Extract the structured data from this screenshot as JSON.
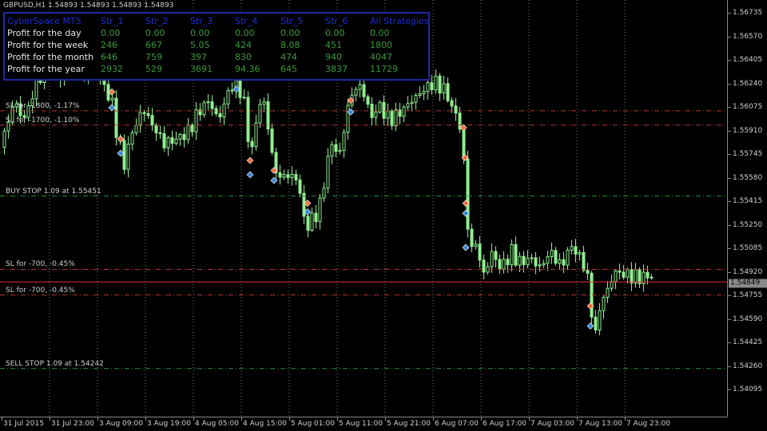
{
  "symbol_info": "GBPUSD,H1  1.54893 1.54893 1.54893 1.54893",
  "price_axis": {
    "labels": [
      "1.56735",
      "1.56570",
      "1.56405",
      "1.56240",
      "1.56075",
      "1.55910",
      "1.55745",
      "1.55580",
      "1.55415",
      "1.55250",
      "1.55085",
      "1.54920",
      "1.54755",
      "1.54590",
      "1.54425",
      "1.54260",
      "1.54095"
    ],
    "current_price": "1.54849"
  },
  "time_axis": {
    "labels": [
      "31 Jul 2015",
      "31 Jul 23:00",
      "3 Aug 09:00",
      "3 Aug 19:00",
      "4 Aug 05:00",
      "4 Aug 15:00",
      "5 Aug 01:00",
      "5 Aug 11:00",
      "5 Aug 21:00",
      "6 Aug 07:00",
      "6 Aug 17:00",
      "7 Aug 03:00",
      "7 Aug 13:00",
      "7 Aug 23:00"
    ]
  },
  "lines": [
    {
      "label": "SL for -1800, -1.17%",
      "color": "#b03a2e",
      "price": 1.56048
    },
    {
      "label": "SL for -1700, -1.10%",
      "color": "#b03a2e",
      "price": 1.55948
    },
    {
      "label": "BUY STOP 1.09 at 1.55451",
      "color": "#2e8a3a",
      "price": 1.55451
    },
    {
      "label": "SL for -700, -0.45%",
      "color": "#b03a2e",
      "price": 1.54937
    },
    {
      "label": "",
      "color": "#e03030",
      "price": 1.54849
    },
    {
      "label": "SL for -700, -0.45%",
      "color": "#b03a2e",
      "price": 1.54757
    },
    {
      "label": "SELL STOP 1.09 at 1.54242",
      "color": "#2e8a3a",
      "price": 1.54242
    }
  ],
  "stats_panel": {
    "headers": [
      "CyberSpace MT5",
      "Str_1",
      "Str_2",
      "Str_3",
      "Str_4",
      "Str_5",
      "Str_6",
      "All Strategies"
    ],
    "rows": [
      {
        "label": "Profit for the day",
        "values": [
          "0.00",
          "0.00",
          "0.00",
          "0.00",
          "0.00",
          "0.00",
          "0.00"
        ]
      },
      {
        "label": "Profit for the week",
        "values": [
          "246",
          "667",
          "5.05",
          "424",
          "8.08",
          "451",
          "1800"
        ]
      },
      {
        "label": "Profit for the month",
        "values": [
          "646",
          "759",
          "397",
          "830",
          "474",
          "940",
          "4047"
        ]
      },
      {
        "label": "Profit for the year",
        "values": [
          "2932",
          "529",
          "3691",
          "94.36",
          "645",
          "3837",
          "11729"
        ]
      }
    ]
  },
  "chart_data": {
    "type": "candlestick",
    "symbol": "GBPUSD",
    "timeframe": "H1",
    "ylim": [
      1.54,
      1.5685
    ],
    "candle_color": "#90ee90",
    "markers": [
      {
        "price": 1.5618,
        "type": "sell"
      },
      {
        "price": 1.5607,
        "type": "buy"
      },
      {
        "price": 1.5585,
        "type": "sell"
      },
      {
        "price": 1.5575,
        "type": "buy"
      },
      {
        "price": 1.5628,
        "type": "sell"
      },
      {
        "price": 1.562,
        "type": "buy"
      },
      {
        "price": 1.557,
        "type": "sell"
      },
      {
        "price": 1.556,
        "type": "buy"
      },
      {
        "price": 1.5563,
        "type": "sell"
      },
      {
        "price": 1.5556,
        "type": "buy"
      },
      {
        "price": 1.554,
        "type": "sell"
      },
      {
        "price": 1.5534,
        "type": "buy"
      },
      {
        "price": 1.5612,
        "type": "sell"
      },
      {
        "price": 1.5604,
        "type": "buy"
      },
      {
        "price": 1.5593,
        "type": "sell"
      },
      {
        "price": 1.5572,
        "type": "sell"
      },
      {
        "price": 1.554,
        "type": "sell"
      },
      {
        "price": 1.5533,
        "type": "buy"
      },
      {
        "price": 1.5509,
        "type": "buy"
      },
      {
        "price": 1.5468,
        "type": "sell"
      },
      {
        "price": 1.5454,
        "type": "buy"
      }
    ]
  }
}
